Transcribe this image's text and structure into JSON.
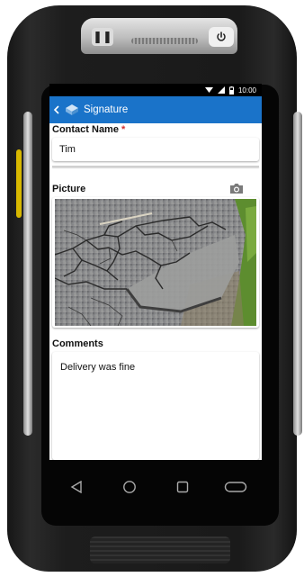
{
  "status_bar": {
    "time": "10:00"
  },
  "app_bar": {
    "title": "Signature"
  },
  "form": {
    "contact_name_label": "Contact Name",
    "required_mark": "*",
    "contact_name_value": "Tim",
    "picture_label": "Picture",
    "comments_label": "Comments",
    "comments_value": "Delivery was fine"
  },
  "icons": {
    "back": "chevron-left-icon",
    "app": "app-logo-icon",
    "camera": "camera-icon",
    "nav": [
      "nav-back-icon",
      "nav-home-icon",
      "nav-recents-icon",
      "nav-menu-icon"
    ]
  },
  "colors": {
    "app_bar": "#1a73c9",
    "required": "#d32f2f",
    "device_accent": "#d8b800"
  }
}
